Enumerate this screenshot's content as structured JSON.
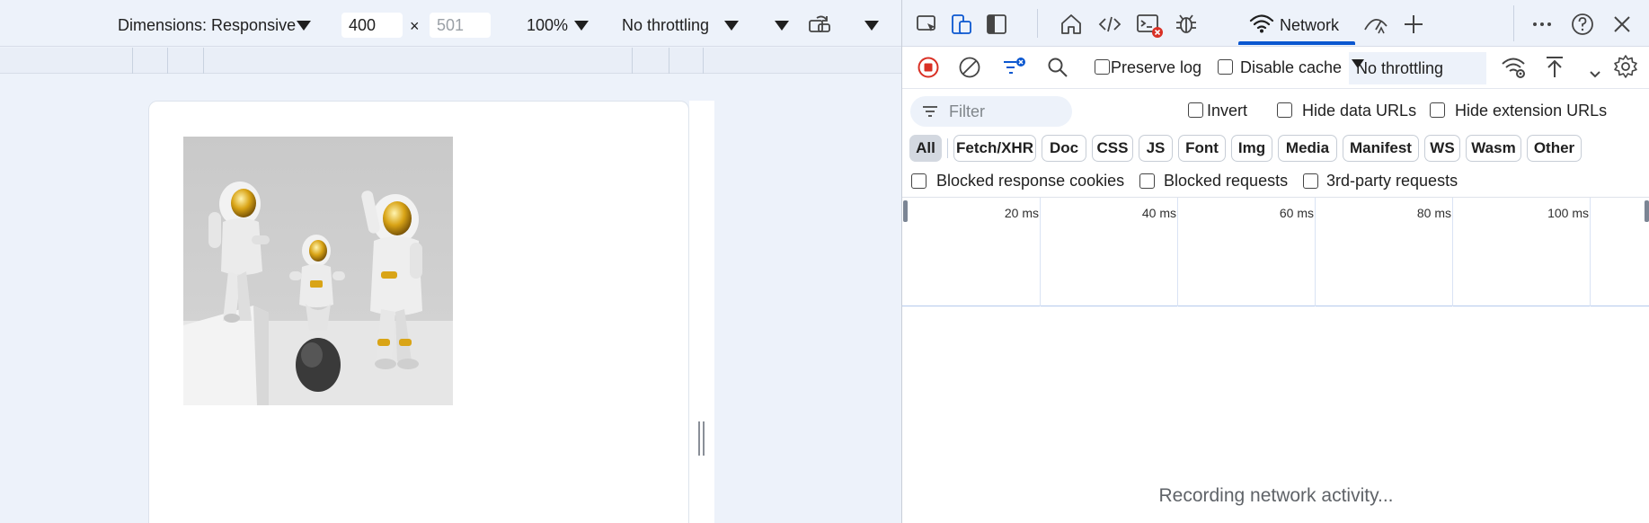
{
  "device_toolbar": {
    "dimensions_label": "Dimensions: Responsive",
    "width_value": "400",
    "times_symbol": "×",
    "height_value": "501",
    "zoom_label": "100%",
    "throttling_label": "No throttling"
  },
  "devtools": {
    "network_tab_label": "Network",
    "toolbar": {
      "preserve_log_label": "Preserve log",
      "disable_cache_label": "Disable cache",
      "throttling_label": "No throttling"
    },
    "filter": {
      "placeholder": "Filter",
      "invert_label": "Invert",
      "hide_data_urls_label": "Hide data URLs",
      "hide_extension_urls_label": "Hide extension URLs"
    },
    "type_filters": [
      "All",
      "Fetch/XHR",
      "Doc",
      "CSS",
      "JS",
      "Font",
      "Img",
      "Media",
      "Manifest",
      "WS",
      "Wasm",
      "Other"
    ],
    "active_type_filter": "All",
    "blocked": {
      "blocked_response_cookies_label": "Blocked response cookies",
      "blocked_requests_label": "Blocked requests",
      "third_party_label": "3rd-party requests"
    },
    "timeline_ticks": [
      "20 ms",
      "40 ms",
      "60 ms",
      "80 ms",
      "100 ms"
    ],
    "status_message": "Recording network activity..."
  },
  "colors": {
    "accent": "#0b57d0",
    "record_red": "#d93025",
    "toolbar_bg": "#edf2fa"
  },
  "icons": [
    "inspect-icon",
    "device-toolbar-icon",
    "dock-icon",
    "home-icon",
    "elements-icon",
    "console-icon",
    "sources-icon",
    "network-wifi-icon",
    "performance-icon",
    "add-icon",
    "more-icon",
    "help-icon",
    "close-icon",
    "record-icon",
    "clear-icon",
    "filter-toggle-icon",
    "search-icon",
    "network-conditions-icon",
    "import-icon",
    "export-icon",
    "settings-icon",
    "resize-handle-icon"
  ]
}
